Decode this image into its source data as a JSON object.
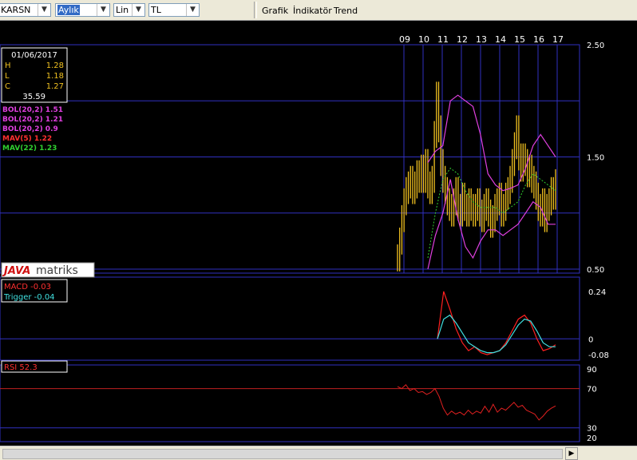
{
  "toolbar": {
    "symbol": "KARSN",
    "period": "Aylık",
    "scale": "Lin",
    "currency": "TL",
    "menu": [
      "Grafik",
      "İndikatör",
      "Trend"
    ]
  },
  "info_box": {
    "date": "01/06/2017",
    "rows": [
      {
        "label": "H",
        "value": "1.28"
      },
      {
        "label": "L",
        "value": "1.18"
      },
      {
        "label": "C",
        "value": "1.27"
      }
    ],
    "volume": "35.59"
  },
  "price_legend": [
    {
      "text": "BOL(20,2) 1.51",
      "color": "#e040e0"
    },
    {
      "text": "BOL(20,2) 1.21",
      "color": "#e040e0"
    },
    {
      "text": "BOL(20,2) 0.9",
      "color": "#e040e0"
    },
    {
      "text": "MAV(5) 1.22",
      "color": "#ff3030"
    },
    {
      "text": "MAV(22) 1.23",
      "color": "#30d030"
    }
  ],
  "logo": {
    "part1": "JAVA",
    "part2": "matriks"
  },
  "macd_legend": [
    {
      "text": "MACD -0.03",
      "color": "#ff3030"
    },
    {
      "text": "Trigger -0.04",
      "color": "#40e0e0"
    }
  ],
  "rsi_legend": {
    "text": "RSI 52.3",
    "color": "#ff3030"
  },
  "colors": {
    "grid": "#3030c0",
    "candle": "#f0c020",
    "axis_text": "#ffffff",
    "rsi_line": "#e02020"
  },
  "chart_data": [
    {
      "type": "candlestick",
      "name": "price",
      "x_labels": [
        "09",
        "10",
        "11",
        "12",
        "13",
        "14",
        "15",
        "16",
        "17"
      ],
      "y_ticks": [
        "2.50",
        "1.50",
        "0.50"
      ],
      "ylim": [
        0.5,
        2.5
      ],
      "close": [
        0.6,
        0.75,
        0.95,
        1.1,
        1.2,
        1.25,
        1.3,
        1.2,
        1.25,
        1.35,
        1.3,
        1.4,
        1.3,
        1.45,
        1.25,
        1.2,
        1.3,
        1.7,
        2.05,
        1.75,
        1.45,
        1.3,
        1.2,
        1.1,
        1.05,
        1.0,
        1.1,
        1.2,
        1.05,
        1.0,
        1.15,
        1.05,
        1.0,
        1.1,
        1.05,
        1.0,
        1.05,
        1.1,
        1.0,
        0.95,
        1.05,
        1.1,
        1.0,
        0.9,
        0.95,
        1.05,
        1.1,
        1.15,
        1.0,
        1.05,
        1.15,
        1.2,
        1.3,
        1.45,
        1.6,
        1.75,
        1.5,
        1.4,
        1.5,
        1.45,
        1.35,
        1.4,
        1.3,
        1.25,
        1.15,
        1.05,
        1.0,
        1.1,
        0.95,
        1.05,
        1.1,
        1.2,
        1.15,
        1.27
      ],
      "bollinger_upper": [
        1.45,
        1.55,
        1.6,
        2.0,
        2.05,
        2.0,
        1.95,
        1.7,
        1.35,
        1.25,
        1.2,
        1.22,
        1.25,
        1.4,
        1.6,
        1.7,
        1.6,
        1.5
      ],
      "bollinger_lower": [
        0.5,
        0.8,
        1.0,
        1.3,
        0.95,
        0.7,
        0.6,
        0.75,
        0.85,
        0.85,
        0.8,
        0.85,
        0.9,
        1.0,
        1.1,
        1.05,
        0.9,
        0.9
      ],
      "mav22": [
        0.6,
        1.0,
        1.3,
        1.4,
        1.35,
        1.2,
        1.1,
        1.05,
        1.05,
        1.05,
        1.0,
        1.05,
        1.1,
        1.25,
        1.35,
        1.3,
        1.25,
        1.2
      ]
    },
    {
      "type": "line",
      "name": "macd",
      "y_ticks": [
        "0.24",
        "0",
        "-0.08"
      ],
      "ylim": [
        -0.1,
        0.26
      ],
      "series": [
        {
          "name": "MACD",
          "values": [
            0.0,
            0.24,
            0.15,
            0.05,
            -0.02,
            -0.06,
            -0.04,
            -0.07,
            -0.08,
            -0.07,
            -0.06,
            -0.02,
            0.04,
            0.1,
            0.12,
            0.08,
            0.0,
            -0.06,
            -0.05,
            -0.03
          ]
        },
        {
          "name": "Trigger",
          "values": [
            0.0,
            0.1,
            0.12,
            0.08,
            0.03,
            -0.02,
            -0.04,
            -0.06,
            -0.07,
            -0.07,
            -0.06,
            -0.03,
            0.02,
            0.07,
            0.1,
            0.09,
            0.04,
            -0.02,
            -0.04,
            -0.04
          ]
        }
      ]
    },
    {
      "type": "line",
      "name": "rsi",
      "y_ticks": [
        "90",
        "70",
        "30",
        "20"
      ],
      "ylim": [
        20,
        90
      ],
      "series": [
        {
          "name": "RSI",
          "values": [
            72,
            70,
            74,
            68,
            70,
            66,
            67,
            64,
            66,
            70,
            62,
            50,
            43,
            47,
            44,
            46,
            43,
            48,
            44,
            47,
            45,
            52,
            46,
            54,
            46,
            50,
            48,
            52,
            56,
            51,
            53,
            48,
            46,
            44,
            38,
            42,
            47,
            50,
            52.3
          ]
        }
      ]
    }
  ]
}
